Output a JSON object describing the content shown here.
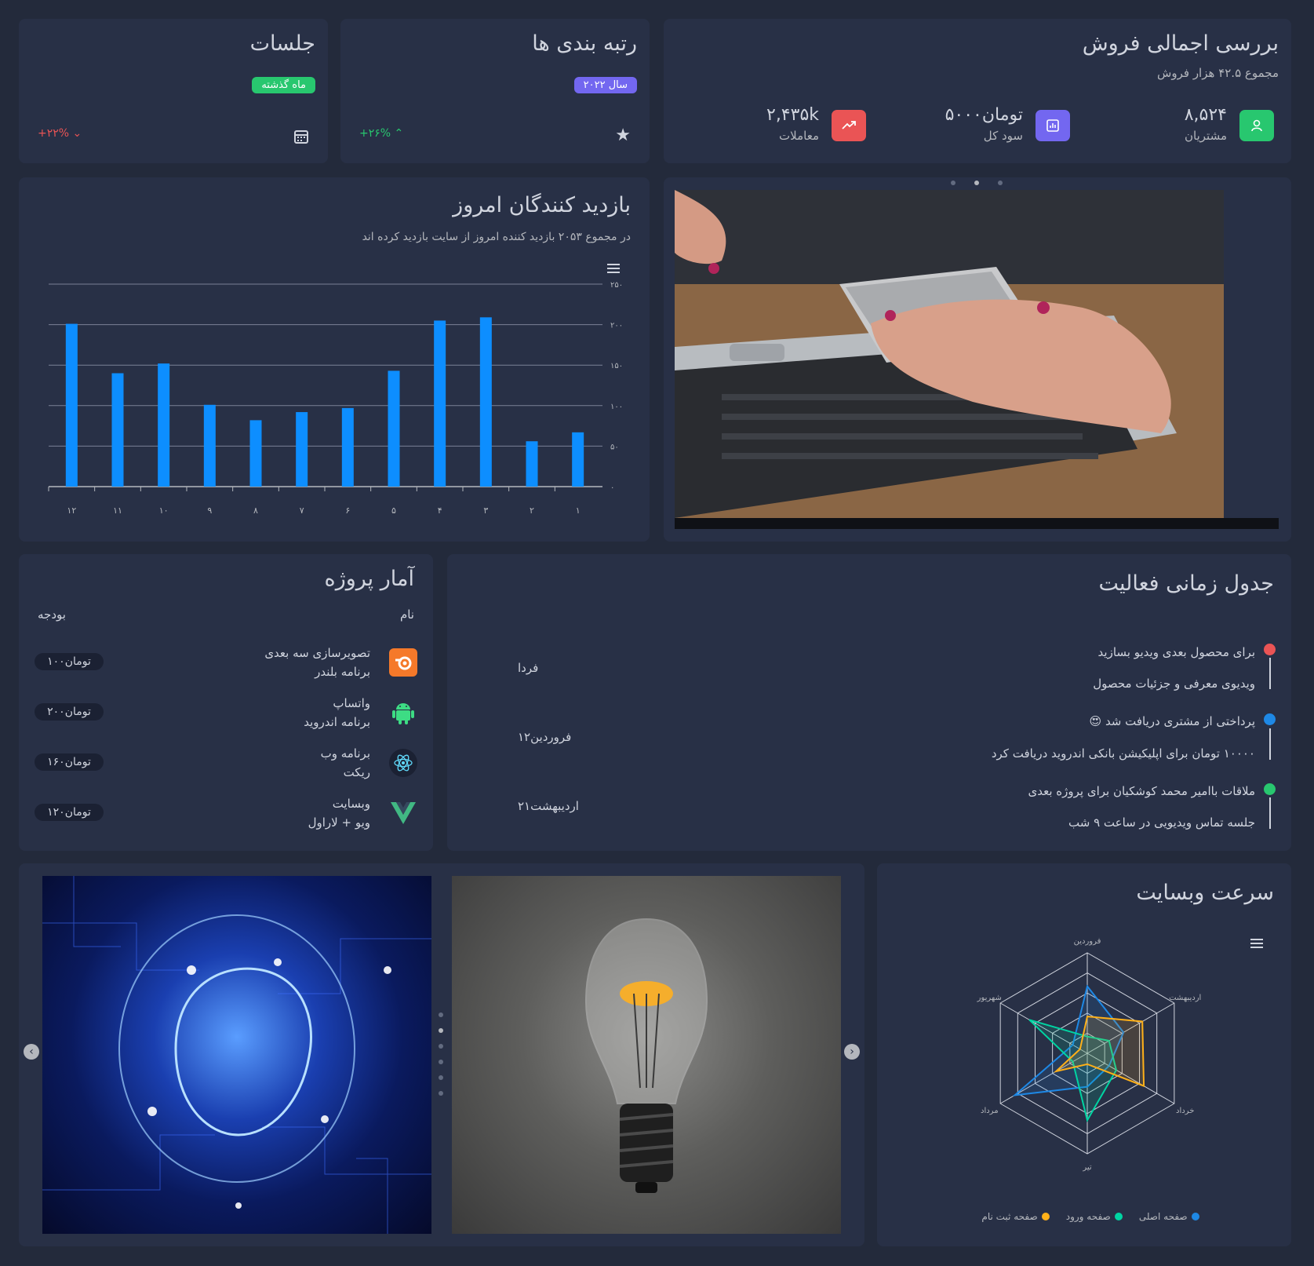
{
  "sessions": {
    "title": "جلسات",
    "badge": "ماه گذشته",
    "change": "+۲۲% ⌄",
    "colors": {
      "badge": "#28c76f",
      "change": "#ea5455"
    }
  },
  "rankings": {
    "title": "رتبه بندی ها",
    "badge": "سال ۲۰۲۲",
    "change": "+۲۶% ⌃",
    "colors": {
      "badge": "#7367f0",
      "change": "#28c76f"
    }
  },
  "sales": {
    "title": "بررسی اجمالی فروش",
    "subtitle": "مجموع ۴۲.۵ هزار فروش",
    "stats": [
      {
        "value": "۸,۵۲۴",
        "label": "مشتریان",
        "icon": "user-icon",
        "color": "#28c76f"
      },
      {
        "value": "۵۰۰۰تومان",
        "label": "سود کل",
        "icon": "bar-chart-icon",
        "color": "#7367f0"
      },
      {
        "value": "۲,۴۳۵k",
        "label": "معاملات",
        "icon": "trending-up-icon",
        "color": "#ea5455"
      }
    ]
  },
  "visitors": {
    "title": "بازدید کنندگان امروز",
    "subtitle": "در مجموع ۲۰۵۳ بازدید کننده امروز از سایت بازدید کرده اند"
  },
  "chart_data": [
    {
      "type": "bar",
      "categories": [
        "۱۲",
        "۱۱",
        "۱۰",
        "۹",
        "۸",
        "۷",
        "۶",
        "۵",
        "۴",
        "۳",
        "۲",
        "۱"
      ],
      "values": [
        201,
        140,
        152,
        101,
        82,
        92,
        97,
        143,
        205,
        209,
        56,
        67
      ],
      "ylim": [
        0,
        250
      ],
      "yticks": [
        "۰",
        "۵۰",
        "۱۰۰",
        "۱۵۰",
        "۲۰۰",
        "۲۵۰"
      ],
      "grid": true,
      "color": "#0d8eff"
    },
    {
      "type": "radar",
      "categories": [
        "فروردین",
        "اردیبهشت",
        "خرداد",
        "تیر",
        "مرداد",
        "شهریور"
      ],
      "rlim": [
        0,
        120
      ],
      "series": [
        {
          "name": "صفحه اصلی",
          "color": "#1e88e5",
          "values": [
            80,
            50,
            30,
            40,
            100,
            20
          ]
        },
        {
          "name": "صفحه ورود",
          "color": "#00d4a2",
          "values": [
            20,
            30,
            40,
            80,
            20,
            80
          ]
        },
        {
          "name": "صفحه ثبت نام",
          "color": "#feb019",
          "values": [
            44,
            76,
            78,
            13,
            43,
            10
          ]
        }
      ]
    }
  ],
  "project_stats": {
    "title": "آمار پروژه",
    "col_name": "نام",
    "col_budget": "بودجه",
    "rows": [
      {
        "line1": "تصویرسازی سه بعدی",
        "line2": "برنامه بلندر",
        "budget": "۱۰۰تومان",
        "icon": "blender-icon",
        "color": "#f5792a"
      },
      {
        "line1": "واتساپ",
        "line2": "برنامه اندروید",
        "budget": "۲۰۰تومان",
        "icon": "android-icon",
        "color": "#3ddc84"
      },
      {
        "line1": "برنامه وب",
        "line2": "ریکت",
        "budget": "۱۶۰تومان",
        "icon": "react-icon",
        "color": "#61dafb"
      },
      {
        "line1": "وبسایت",
        "line2": "ویو + لاراول",
        "budget": "۱۲۰تومان",
        "icon": "vue-icon",
        "color": "#41b883"
      }
    ]
  },
  "timeline": {
    "title": "جدول زمانی فعالیت",
    "items": [
      {
        "title": "برای محصول بعدی ویدیو بسازید",
        "desc": "ویدیوی معرفی و جزئیات محصول",
        "date": "فردا",
        "color": "#ea5455"
      },
      {
        "title": "پرداختی از مشتری دریافت شد",
        "desc": "۱۰۰۰۰ تومان برای اپلیکیشن بانکی اندروید دریافت کرد",
        "date": "۱۲فروردین",
        "color": "#1e88e5",
        "emoji": "😍"
      },
      {
        "title": "ملاقات باامیر محمد کوشکیان برای پروژه بعدی",
        "desc": "جلسه تماس ویدیویی در ساعت ۹ شب",
        "date": "۲۱اردیبهشت",
        "color": "#28c76f"
      }
    ]
  },
  "speed": {
    "title": "سرعت وبسایت"
  }
}
